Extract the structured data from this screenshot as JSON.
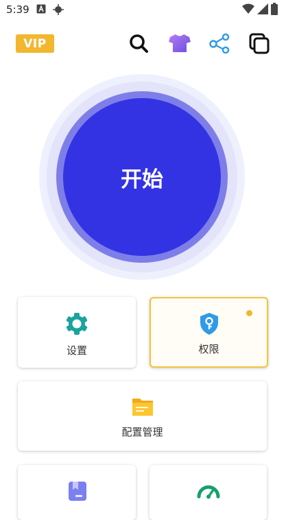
{
  "status_bar": {
    "time": "5:39",
    "icons": [
      "text-a-icon",
      "gps-icon",
      "wifi-icon",
      "signal-icon",
      "battery-icon"
    ]
  },
  "top_bar": {
    "vip_label": "VIP",
    "icons": [
      "search-icon",
      "theme-shirt-icon",
      "share-icon",
      "copy-icon"
    ]
  },
  "start_button": {
    "label": "开始"
  },
  "cards": {
    "settings": {
      "label": "设置",
      "icon": "settings-gear-icon"
    },
    "permissions": {
      "label": "权限",
      "icon": "shield-key-icon",
      "badge": true
    },
    "config": {
      "label": "配置管理",
      "icon": "folder-icon"
    },
    "bottom_left": {
      "icon": "bookmark-icon"
    },
    "bottom_right": {
      "icon": "speedometer-icon"
    }
  },
  "colors": {
    "accent": "#3333e4",
    "vip": "#f2b72f",
    "teal": "#1ba39c",
    "blue": "#2f9be8",
    "folder": "#fbbf25",
    "bookmark": "#7b7ff0",
    "gauge": "#16a06c"
  }
}
